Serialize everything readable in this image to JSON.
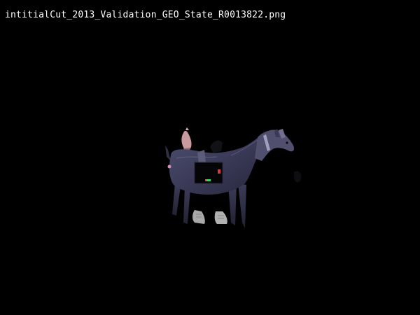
{
  "viewer": {
    "filename": "intitialCut_2013_Validation_GEO_State_R0013822.png",
    "background": "#000000",
    "text_color": "#ffffff"
  },
  "image": {
    "subject": "goat",
    "elements": [
      "goat",
      "harness-pouch",
      "shoes",
      "hand"
    ]
  }
}
